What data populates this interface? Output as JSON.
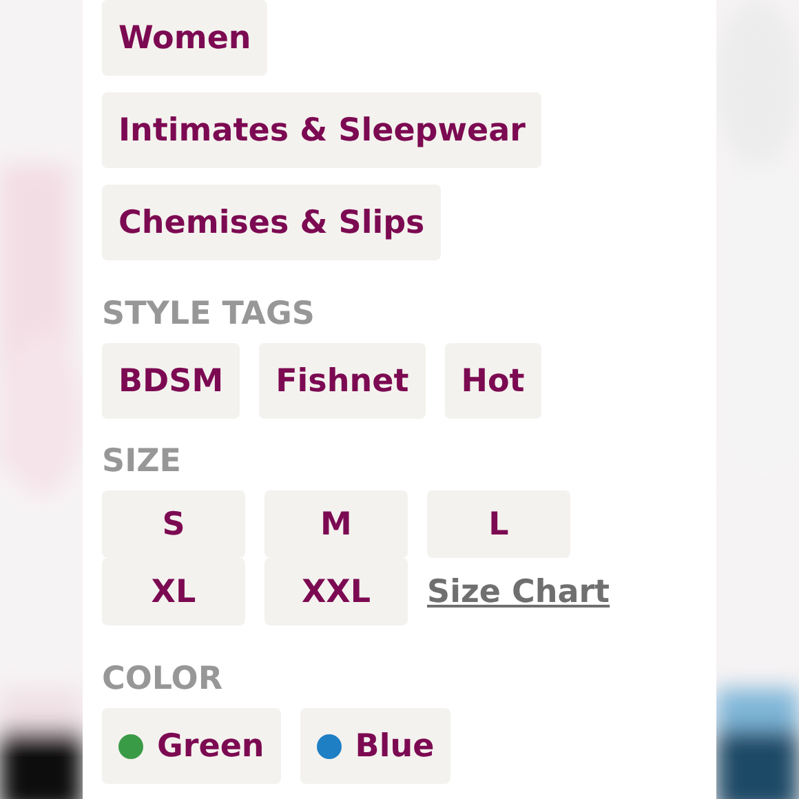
{
  "categories": [
    "Women",
    "Intimates & Sleepwear",
    "Chemises & Slips"
  ],
  "style_tags": {
    "label": "STYLE TAGS",
    "tags": [
      "BDSM",
      "Fishnet",
      "Hot"
    ]
  },
  "size": {
    "label": "SIZE",
    "options": [
      "S",
      "M",
      "L",
      "XL",
      "XXL"
    ],
    "size_chart_link": "Size Chart"
  },
  "color": {
    "label": "COLOR",
    "options": [
      {
        "label": "Green",
        "color": "#3a9b46"
      },
      {
        "label": "Blue",
        "color": "#1f7fc4"
      }
    ]
  }
}
